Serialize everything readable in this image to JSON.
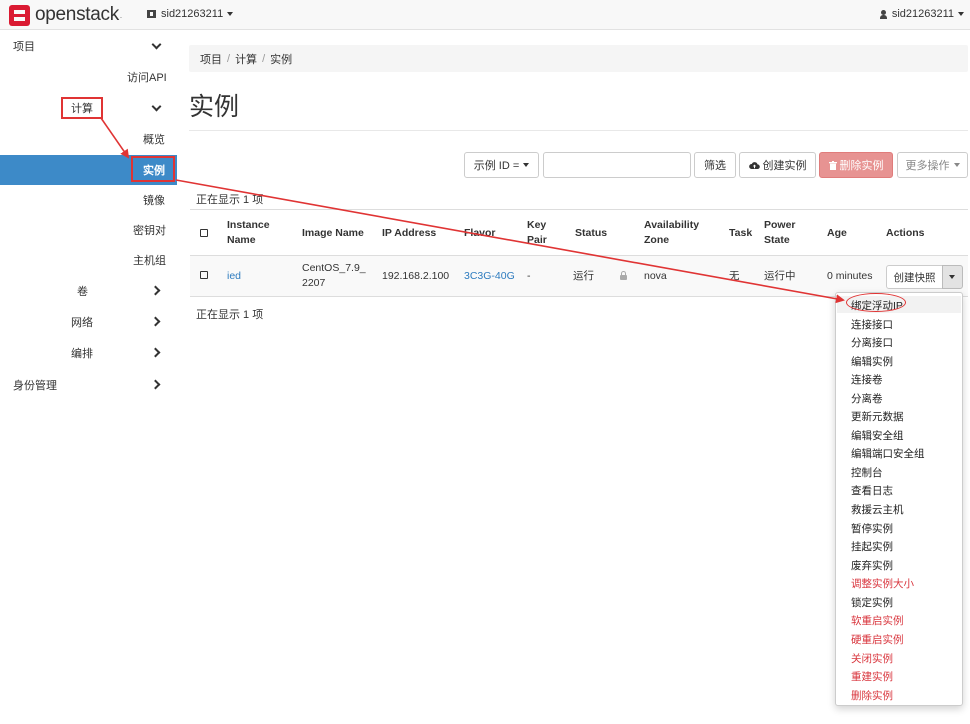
{
  "navbar": {
    "brand": "openstack",
    "brand_suffix": ".",
    "project": "sid21263211",
    "user": "sid21263211"
  },
  "sidebar": {
    "project": "项目",
    "api_access": "访问API",
    "compute": "计算",
    "overview": "概览",
    "instances": "实例",
    "images": "镜像",
    "key_pairs": "密钥对",
    "server_groups": "主机组",
    "volumes": "卷",
    "network": "网络",
    "orchestration": "编排",
    "identity": "身份管理"
  },
  "breadcrumb": [
    "项目",
    "计算",
    "实例"
  ],
  "page_title": "实例",
  "toolbar": {
    "filter_select": "示例 ID =",
    "filter_placeholder": "",
    "filter_button": "筛选",
    "launch_button": "创建实例",
    "delete_button": "删除实例",
    "more_actions": "更多操作"
  },
  "count_text_top": "正在显示 1 项",
  "count_text_bottom": "正在显示 1 项",
  "table": {
    "headers": {
      "name": [
        "Instance",
        "Name"
      ],
      "image": "Image Name",
      "ip": "IP Address",
      "flavor": "Flavor",
      "keypair": [
        "Key",
        "Pair"
      ],
      "status": "Status",
      "az": [
        "Availability",
        "Zone"
      ],
      "task": "Task",
      "power": [
        "Power",
        "State"
      ],
      "age": "Age",
      "actions": "Actions"
    },
    "rows": [
      {
        "name": "ied",
        "image": [
          "CentOS_7.9_",
          "2207"
        ],
        "ip": "192.168.2.100",
        "flavor": "3C3G-40G",
        "keypair": "-",
        "status": "运行",
        "az": "nova",
        "task": "无",
        "power": "运行中",
        "age": "0 minutes",
        "action": "创建快照"
      }
    ]
  },
  "dropdown": [
    {
      "label": "绑定浮动IP",
      "danger": false
    },
    {
      "label": "连接接口",
      "danger": false
    },
    {
      "label": "分离接口",
      "danger": false
    },
    {
      "label": "编辑实例",
      "danger": false
    },
    {
      "label": "连接卷",
      "danger": false
    },
    {
      "label": "分离卷",
      "danger": false
    },
    {
      "label": "更新元数据",
      "danger": false
    },
    {
      "label": "编辑安全组",
      "danger": false
    },
    {
      "label": "编辑端口安全组",
      "danger": false
    },
    {
      "label": "控制台",
      "danger": false
    },
    {
      "label": "查看日志",
      "danger": false
    },
    {
      "label": "救援云主机",
      "danger": false
    },
    {
      "label": "暂停实例",
      "danger": false
    },
    {
      "label": "挂起实例",
      "danger": false
    },
    {
      "label": "废弃实例",
      "danger": false
    },
    {
      "label": "调整实例大小",
      "danger": true
    },
    {
      "label": "锁定实例",
      "danger": false
    },
    {
      "label": "软重启实例",
      "danger": true
    },
    {
      "label": "硬重启实例",
      "danger": true
    },
    {
      "label": "关闭实例",
      "danger": true
    },
    {
      "label": "重建实例",
      "danger": true
    },
    {
      "label": "删除实例",
      "danger": true
    }
  ],
  "colors": {
    "accent": "#3d8ac8",
    "annotation": "#e03434",
    "danger": "#d9363e",
    "link": "#2e7cbf"
  }
}
